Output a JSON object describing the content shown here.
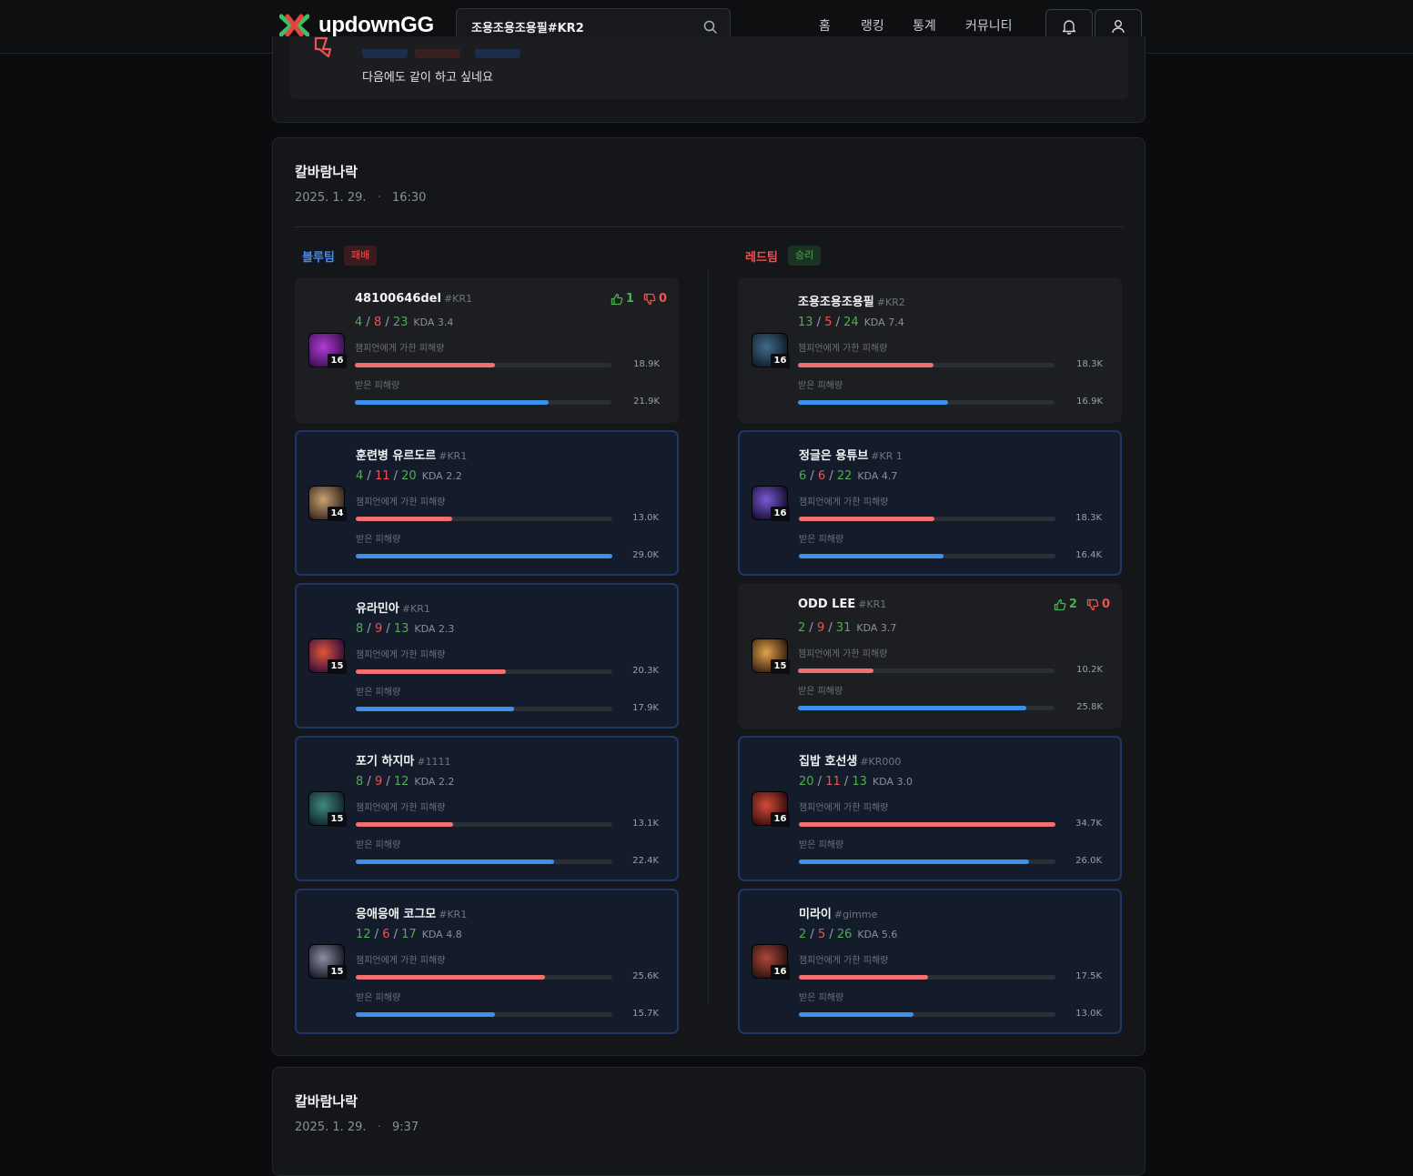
{
  "header": {
    "logo_text": "updownGG",
    "search_value": "조용조용조용필#KR2",
    "nav": [
      "홈",
      "랭킹",
      "통계",
      "커뮤니티"
    ]
  },
  "review": {
    "text": "다음에도 같이 하고 싶네요"
  },
  "matches": [
    {
      "title": "칼바람나락",
      "date": "2025. 1. 29.",
      "time": "16:30",
      "blue": {
        "label": "블루팀",
        "result": "패배",
        "players": [
          {
            "name": "48100646del",
            "tag": "#KR1",
            "k": "4",
            "d": "8",
            "a": "23",
            "kda": "KDA 3.4",
            "level": "16",
            "dealt_label": "챔피언에게 가한 피해량",
            "dealt": "18.9K",
            "taken_label": "받은 피해량",
            "taken": "21.9K",
            "up": "1",
            "down": "0"
          },
          {
            "name": "훈련병 유르도르",
            "tag": "#KR1",
            "k": "4",
            "d": "11",
            "a": "20",
            "kda": "KDA 2.2",
            "level": "14",
            "dealt_label": "챔피언에게 가한 피해량",
            "dealt": "13.0K",
            "taken_label": "받은 피해량",
            "taken": "29.0K"
          },
          {
            "name": "유라민아",
            "tag": "#KR1",
            "k": "8",
            "d": "9",
            "a": "13",
            "kda": "KDA 2.3",
            "level": "15",
            "dealt_label": "챔피언에게 가한 피해량",
            "dealt": "20.3K",
            "taken_label": "받은 피해량",
            "taken": "17.9K"
          },
          {
            "name": "포기 하지마",
            "tag": "#1111",
            "k": "8",
            "d": "9",
            "a": "12",
            "kda": "KDA 2.2",
            "level": "15",
            "dealt_label": "챔피언에게 가한 피해량",
            "dealt": "13.1K",
            "taken_label": "받은 피해량",
            "taken": "22.4K"
          },
          {
            "name": "응애응애 코그모",
            "tag": "#KR1",
            "k": "12",
            "d": "6",
            "a": "17",
            "kda": "KDA 4.8",
            "level": "15",
            "dealt_label": "챔피언에게 가한 피해량",
            "dealt": "25.6K",
            "taken_label": "받은 피해량",
            "taken": "15.7K"
          }
        ]
      },
      "red": {
        "label": "레드팀",
        "result": "승리",
        "players": [
          {
            "name": "조용조용조용필",
            "tag": "#KR2",
            "k": "13",
            "d": "5",
            "a": "24",
            "kda": "KDA 7.4",
            "level": "16",
            "dealt_label": "챔피언에게 가한 피해량",
            "dealt": "18.3K",
            "taken_label": "받은 피해량",
            "taken": "16.9K"
          },
          {
            "name": "정글은 용튜브",
            "tag": "#KR 1",
            "k": "6",
            "d": "6",
            "a": "22",
            "kda": "KDA 4.7",
            "level": "16",
            "dealt_label": "챔피언에게 가한 피해량",
            "dealt": "18.3K",
            "taken_label": "받은 피해량",
            "taken": "16.4K"
          },
          {
            "name": "ODD LEE",
            "tag": "#KR1",
            "k": "2",
            "d": "9",
            "a": "31",
            "kda": "KDA 3.7",
            "level": "15",
            "dealt_label": "챔피언에게 가한 피해량",
            "dealt": "10.2K",
            "taken_label": "받은 피해량",
            "taken": "25.8K",
            "up": "2",
            "down": "0"
          },
          {
            "name": "집밥 호선생",
            "tag": "#KR000",
            "k": "20",
            "d": "11",
            "a": "13",
            "kda": "KDA 3.0",
            "level": "16",
            "dealt_label": "챔피언에게 가한 피해량",
            "dealt": "34.7K",
            "taken_label": "받은 피해량",
            "taken": "26.0K"
          },
          {
            "name": "미라이",
            "tag": "#gimme",
            "k": "2",
            "d": "5",
            "a": "26",
            "kda": "KDA 5.6",
            "level": "16",
            "dealt_label": "챔피언에게 가한 피해량",
            "dealt": "17.5K",
            "taken_label": "받은 피해량",
            "taken": "13.0K"
          }
        ]
      }
    },
    {
      "title": "칼바람나락",
      "date": "2025. 1. 29.",
      "time": "9:37"
    }
  ],
  "colors": {
    "win": "#4caf50",
    "lose": "#ef5350",
    "blue_team": "#3d8bfd",
    "red_team": "#ef5350",
    "dealt_bar": "#f26f6f",
    "taken_bar": "#3b92e8"
  }
}
